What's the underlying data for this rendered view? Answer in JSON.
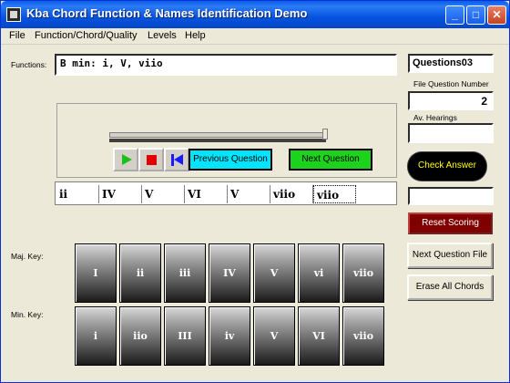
{
  "window": {
    "title": "Kba Chord Function & Names Identification Demo",
    "min": "_",
    "max": "□",
    "close": "✕"
  },
  "menu": [
    "File",
    "Function/Chord/Quality",
    "Levels",
    "Help"
  ],
  "functions": {
    "label": "Functions:",
    "value": "B min: i, V, viio"
  },
  "controls": {
    "previous": "Previous  Question",
    "next": "Next Question",
    "slider_position": 1.0
  },
  "chords": [
    "ii",
    "IV",
    "V",
    "VI",
    "V",
    "viio",
    "viio",
    ""
  ],
  "major_key": {
    "label": "Maj. Key:",
    "buttons": [
      "I",
      "ii",
      "iii",
      "IV",
      "V",
      "vi",
      "viio"
    ]
  },
  "minor_key": {
    "label": "Min. Key:",
    "buttons": [
      "i",
      "iio",
      "III",
      "iv",
      "V",
      "VI",
      "viio"
    ]
  },
  "right": {
    "file_name": "Questions03",
    "file_question_label": "File Question Number",
    "file_question_number": "2",
    "hearings_label": "Av. Hearings",
    "hearings_value": "",
    "check_answer": "Check Answer",
    "result": "",
    "reset_scoring": "Reset Scoring",
    "next_question_file": "Next Question File",
    "erase_all": "Erase All Chords"
  },
  "icons": [
    "play-icon",
    "stop-icon",
    "rewind-icon"
  ],
  "colors": {
    "prev_button": "#00e5ff",
    "next_button": "#1cd21c",
    "check_text": "#ffff00",
    "reset_bg": "#800000"
  }
}
